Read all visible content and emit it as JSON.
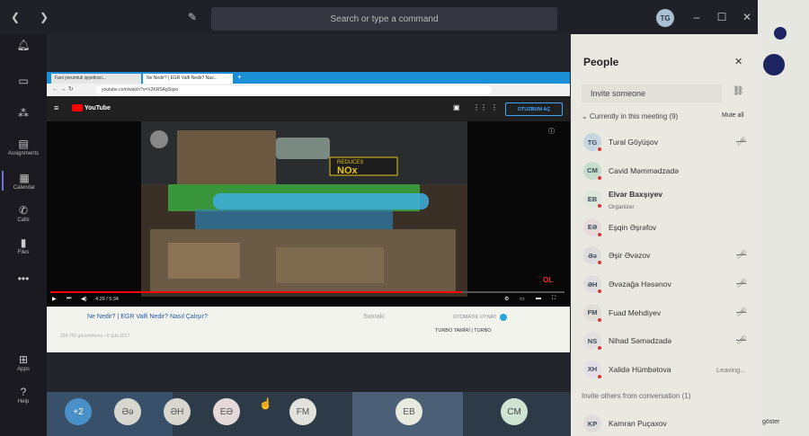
{
  "titlebar": {
    "search_placeholder": "Search or type a command",
    "avatar_initials": "TG",
    "icons": [
      "back-icon",
      "forward-icon",
      "compose-icon",
      "minimize-icon",
      "maximize-icon",
      "close-icon"
    ]
  },
  "rail": {
    "items": [
      {
        "label": "",
        "icon": "bell-icon"
      },
      {
        "label": "",
        "icon": "chat-icon"
      },
      {
        "label": "",
        "icon": "teams-icon"
      },
      {
        "label": "Assignments",
        "icon": "assignments-icon"
      },
      {
        "label": "Calendar",
        "icon": "calendar-icon"
      },
      {
        "label": "Calls",
        "icon": "phone-icon"
      },
      {
        "label": "Files",
        "icon": "files-icon"
      },
      {
        "label": "",
        "icon": "more-icon"
      },
      {
        "label": "Apps",
        "icon": "apps-icon"
      },
      {
        "label": "Help",
        "icon": "help-icon"
      }
    ]
  },
  "browser": {
    "tabs": [
      "Fani yorumluk işiyetinizi...",
      "Ne Nedir? | EGR Valfi Nedir? Nas..."
    ],
    "url": "youtube.com/watch?v=X2KRSAgSqso",
    "subscribe_label": "OTUZBUM AÇ",
    "time": "4:29 / 5:34",
    "progress": 0.8,
    "video_badge": "REDUCES NOx",
    "watermark": "OL",
    "video_title": "Ne Nedir? | EGR Valfi Nedir? Nasıl Çalışır?",
    "video_meta": "324.768 görüntüleme • 8 Şub 2017",
    "search_text": "Sonraki",
    "autoplay_label": "OTOMATİK OYNAT",
    "up_next": "TURBO TAMİRİ | TURBO"
  },
  "gallery": [
    {
      "initials": "+2",
      "bg": "#4a90c8",
      "fg": "#ffffff"
    },
    {
      "initials": "Əə",
      "bg": "#d7d7d0",
      "fg": "#555555"
    },
    {
      "initials": "ƏH",
      "bg": "#d7d7d0",
      "fg": "#555555"
    },
    {
      "initials": "EƏ",
      "bg": "#e4d8d8",
      "fg": "#555555"
    },
    {
      "initials": "FM",
      "bg": "#e2e2dc",
      "fg": "#555555"
    },
    {
      "initials": "EB",
      "bg": "#e6eadf",
      "fg": "#555555"
    },
    {
      "initials": "CM",
      "bg": "#cfe3d3",
      "fg": "#444444"
    }
  ],
  "people": {
    "title": "People",
    "invite_placeholder": "Invite someone",
    "current_label": "Currently in this meeting",
    "current_count": "(9)",
    "mute_all": "Mute all",
    "list": [
      {
        "initials": "TG",
        "name": "Tural Göyüşov",
        "role": "",
        "avatar_bg": "#c5d6e0",
        "mic_off": true,
        "leaving": ""
      },
      {
        "initials": "CM",
        "name": "Cavid Məmmədzadə",
        "role": "",
        "avatar_bg": "#c7ddcb",
        "mic_off": false,
        "leaving": ""
      },
      {
        "initials": "EB",
        "name": "Elvar Baxşıyev",
        "role": "Organizer",
        "avatar_bg": "#dde6dd",
        "mic_off": false,
        "leaving": ""
      },
      {
        "initials": "EƏ",
        "name": "Eşqin Əşrəfov",
        "role": "",
        "avatar_bg": "#e6dada",
        "mic_off": false,
        "leaving": ""
      },
      {
        "initials": "Əə",
        "name": "Əşir Əvəzov",
        "role": "",
        "avatar_bg": "#dcdcdc",
        "mic_off": true,
        "leaving": ""
      },
      {
        "initials": "ƏH",
        "name": "Əvəzağa Həsənov",
        "role": "",
        "avatar_bg": "#dedede",
        "mic_off": true,
        "leaving": ""
      },
      {
        "initials": "FM",
        "name": "Fuad Mehdiyev",
        "role": "",
        "avatar_bg": "#e2ddd6",
        "mic_off": true,
        "leaving": ""
      },
      {
        "initials": "NS",
        "name": "Nihad Səmədzadə",
        "role": "",
        "avatar_bg": "#e0e0e0",
        "mic_off": true,
        "leaving": ""
      },
      {
        "initials": "XH",
        "name": "Xalidə Hümbətova",
        "role": "",
        "avatar_bg": "#e4dfe6",
        "mic_off": false,
        "leaving": "Leaving..."
      }
    ],
    "others_label": "Invite others from conversation",
    "others_count": "(1)",
    "others": [
      {
        "initials": "KP",
        "name": "Kamran Puçaxov",
        "avatar_bg": "#e0dcdc"
      }
    ]
  },
  "side": {
    "label": "göster"
  }
}
